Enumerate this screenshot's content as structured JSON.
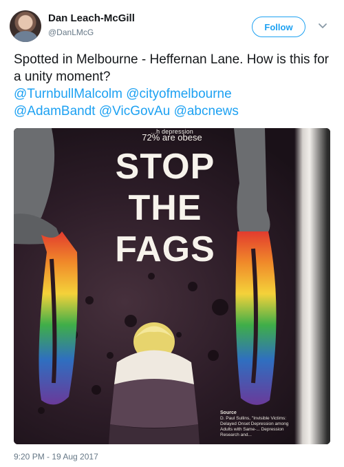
{
  "author": {
    "name": "Dan Leach-McGill",
    "handle": "@DanLMcG"
  },
  "actions": {
    "follow_label": "Follow",
    "menu_icon": "chevron-down-icon"
  },
  "tweet": {
    "text": "Spotted in Melbourne - Heffernan Lane. How is this for a unity moment?",
    "mentions": [
      "@TurnbullMalcolm",
      "@cityofmelbourne",
      "@AdamBandt",
      "@VicGovAu",
      "@abcnews"
    ],
    "timestamp": "9:20 PM - 19 Aug 2017"
  },
  "poster": {
    "top_fragment": "...h depression",
    "stat": "72% are obese",
    "headline": [
      "STOP",
      "THE",
      "FAGS"
    ],
    "source_label": "Source",
    "source_text": "D. Paul Sullins, \"Invisible Victims: Delayed Onset Depression among Adults with Same-... Depression Research and..."
  },
  "colors": {
    "accent": "#1da1f2",
    "text": "#14171a",
    "muted": "#657786",
    "poster_bg": "#2c1c27"
  }
}
